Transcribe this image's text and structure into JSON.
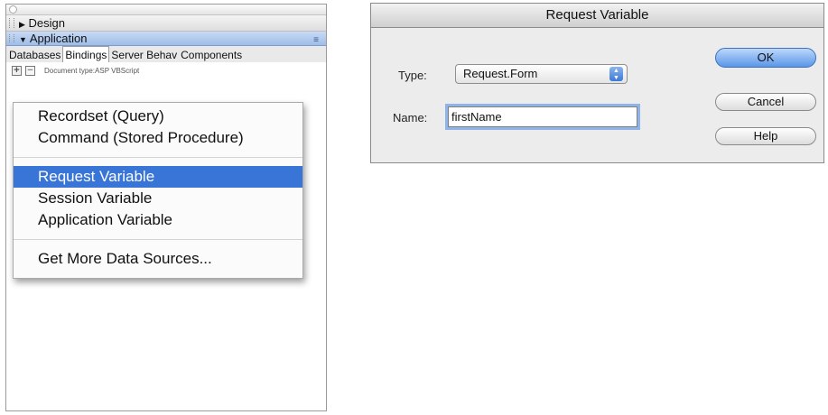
{
  "panel": {
    "design_label": "Design",
    "application_label": "Application",
    "tabs": [
      "Databases",
      "Bindings",
      "Server Behav",
      "Components"
    ],
    "active_tab": "Bindings",
    "add_symbol": "+",
    "remove_symbol": "−",
    "document_type": "Document type:ASP VBScript"
  },
  "menu": {
    "items": [
      "Recordset (Query)",
      "Command (Stored Procedure)",
      "Request Variable",
      "Session Variable",
      "Application Variable",
      "Get More Data Sources..."
    ],
    "selected": "Request Variable"
  },
  "dialog": {
    "title": "Request Variable",
    "type_label": "Type:",
    "type_value": "Request.Form",
    "name_label": "Name:",
    "name_value": "firstName",
    "ok_label": "OK",
    "cancel_label": "Cancel",
    "help_label": "Help"
  },
  "colors": {
    "selection": "#3875d7",
    "application_bar": "#9ebde8",
    "default_button": "#5a96e8"
  }
}
